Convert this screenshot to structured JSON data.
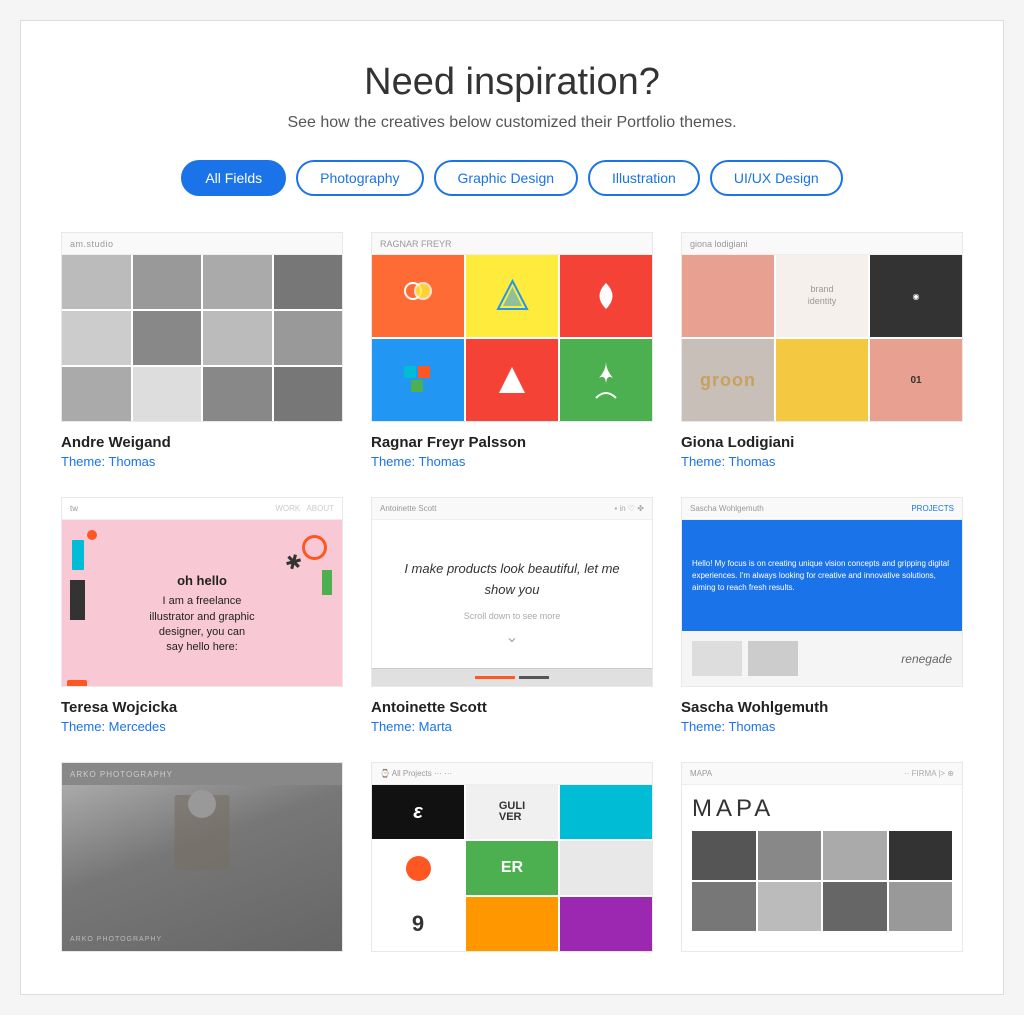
{
  "header": {
    "title": "Need inspiration?",
    "subtitle": "See how the creatives below customized their Portfolio themes."
  },
  "filters": {
    "buttons": [
      {
        "id": "all",
        "label": "All Fields",
        "active": true
      },
      {
        "id": "photography",
        "label": "Photography",
        "active": false
      },
      {
        "id": "graphic-design",
        "label": "Graphic Design",
        "active": false
      },
      {
        "id": "illustration",
        "label": "Illustration",
        "active": false
      },
      {
        "id": "ui-ux",
        "label": "UI/UX Design",
        "active": false
      }
    ]
  },
  "cards": [
    {
      "id": "card1",
      "name": "Andre Weigand",
      "theme_label": "Theme: Thomas",
      "header_text": "am.studio"
    },
    {
      "id": "card2",
      "name": "Ragnar Freyr Palsson",
      "theme_label": "Theme: Thomas",
      "header_text": "RAGNAR FREYR"
    },
    {
      "id": "card3",
      "name": "Giona Lodigiani",
      "theme_label": "Theme: Thomas",
      "header_text": "giona lodigiani"
    },
    {
      "id": "card4",
      "name": "Teresa Wojcicka",
      "theme_label": "Theme: Mercedes",
      "tagline": "oh hello\nI am a freelance\nillustrator and graphic\ndesigner, you can\nsay hello here:"
    },
    {
      "id": "card5",
      "name": "Antoinette Scott",
      "theme_label": "Theme: Marta",
      "tagline": "I make products look beautiful, let me show you",
      "sub": "Scroll down to see more"
    },
    {
      "id": "card6",
      "name": "Sascha Wohlgemuth",
      "theme_label": "Theme: Thomas",
      "blue_text": "Hello! My focus is on creating unique vision concepts and gripping digital experiences. I'm always looking for creative and innovative solutions, aiming to reach fresh results.",
      "bottom_text": "renegade"
    },
    {
      "id": "card7",
      "name": "",
      "theme_label": "",
      "overlay_text": "ARKO PHOTOGRAPHY"
    },
    {
      "id": "card8",
      "name": "",
      "theme_label": "",
      "cells": [
        "ε",
        "GUIVER",
        "",
        "",
        "ER",
        "",
        "9",
        "",
        ""
      ]
    },
    {
      "id": "card9",
      "name": "",
      "theme_label": "",
      "title": "MAPA"
    }
  ]
}
